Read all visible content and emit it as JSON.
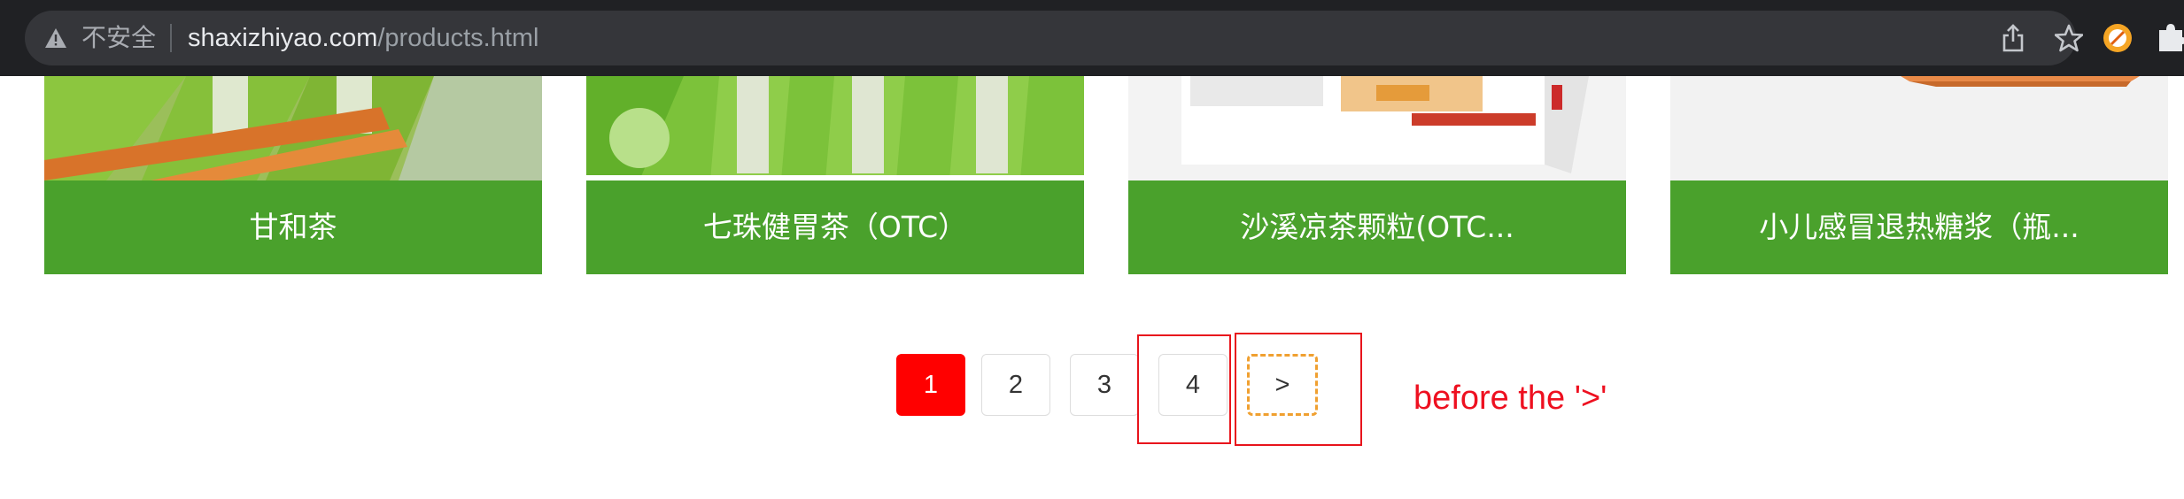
{
  "browser": {
    "security_label": "不安全",
    "url_host": "shaxizhiyao.com",
    "url_path": "/products.html",
    "icons": [
      "not-secure-warning-icon",
      "share-icon",
      "bookmark-star-icon",
      "extension-icon",
      "puzzle-icon"
    ]
  },
  "products": [
    {
      "title": "甘和茶"
    },
    {
      "title": "七珠健胃茶（OTC）"
    },
    {
      "title": "沙溪凉茶颗粒(OTC..."
    },
    {
      "title": "小儿感冒退热糖浆（瓶..."
    }
  ],
  "pagination": {
    "pages": [
      "1",
      "2",
      "3",
      "4"
    ],
    "current": "1",
    "next_label": ">"
  },
  "annotation": {
    "text": "before the '>'",
    "color": "#ee1020"
  },
  "colors": {
    "card_title_bg": "#4aa12c",
    "active_page_bg": "#ff0000",
    "focus_outline": "#f0a030"
  }
}
